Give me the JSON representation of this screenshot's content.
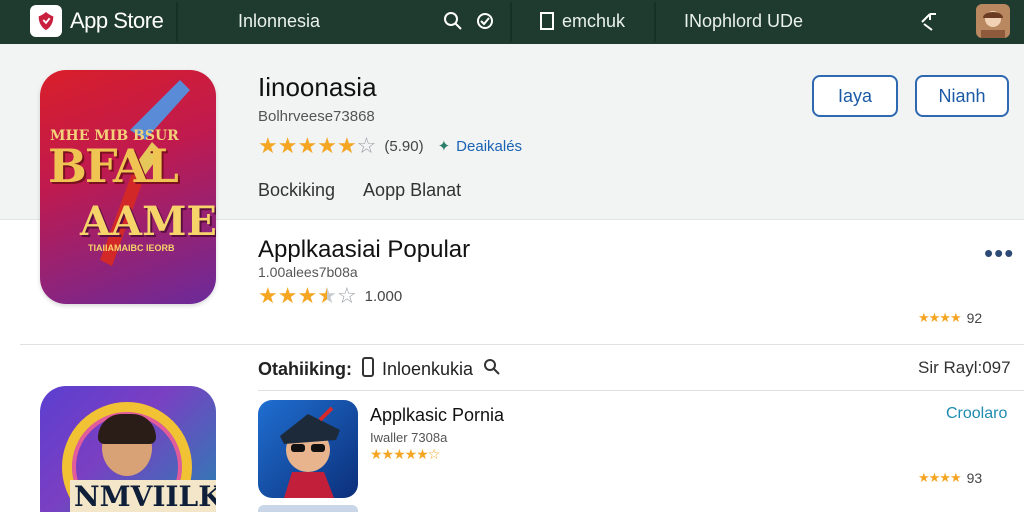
{
  "topbar": {
    "brand": "App Store",
    "search_text": "Inlonnesia",
    "account_text": "emchuk",
    "nav_text": "INophlord UDe"
  },
  "featured": {
    "title": "Iinoonasia",
    "subtitle": "Bolhrveese73868",
    "rating": 4.5,
    "rating_count": "(5.90)",
    "download_label": "Deaikalés",
    "tabs": [
      "Bockiking",
      "Aopp Blanat"
    ],
    "button_primary": "Iaya",
    "button_secondary": "Nianh",
    "icon_text_small": "MHE MIB BSUR",
    "icon_text_big": "BFAL",
    "icon_text_big2": "AAMEB",
    "icon_text_tiny": "TIAIIAMAIBC IEORB"
  },
  "popular": {
    "title": "Applkaasiai Popular",
    "subtitle": "1.00alees7b08a",
    "rating": 3.5,
    "rating_count": "1.000",
    "right_stars": "★★★★",
    "right_count": "92"
  },
  "filter": {
    "label": "Otahiiking:",
    "value": "Inloenkukia",
    "sort_label": "Sir Rayl:097"
  },
  "app2": {
    "title": "Applkasic Pornia",
    "subtitle": "Iwaller 7308a",
    "stars": "★★★★★☆",
    "action": "Croolaro",
    "right_stars": "★★★★",
    "right_count": "93"
  },
  "left_icon2_text": "NMVIILK",
  "colors": {
    "topbar": "#1f3b30",
    "accent": "#2d68b0",
    "star": "#f4a623"
  }
}
